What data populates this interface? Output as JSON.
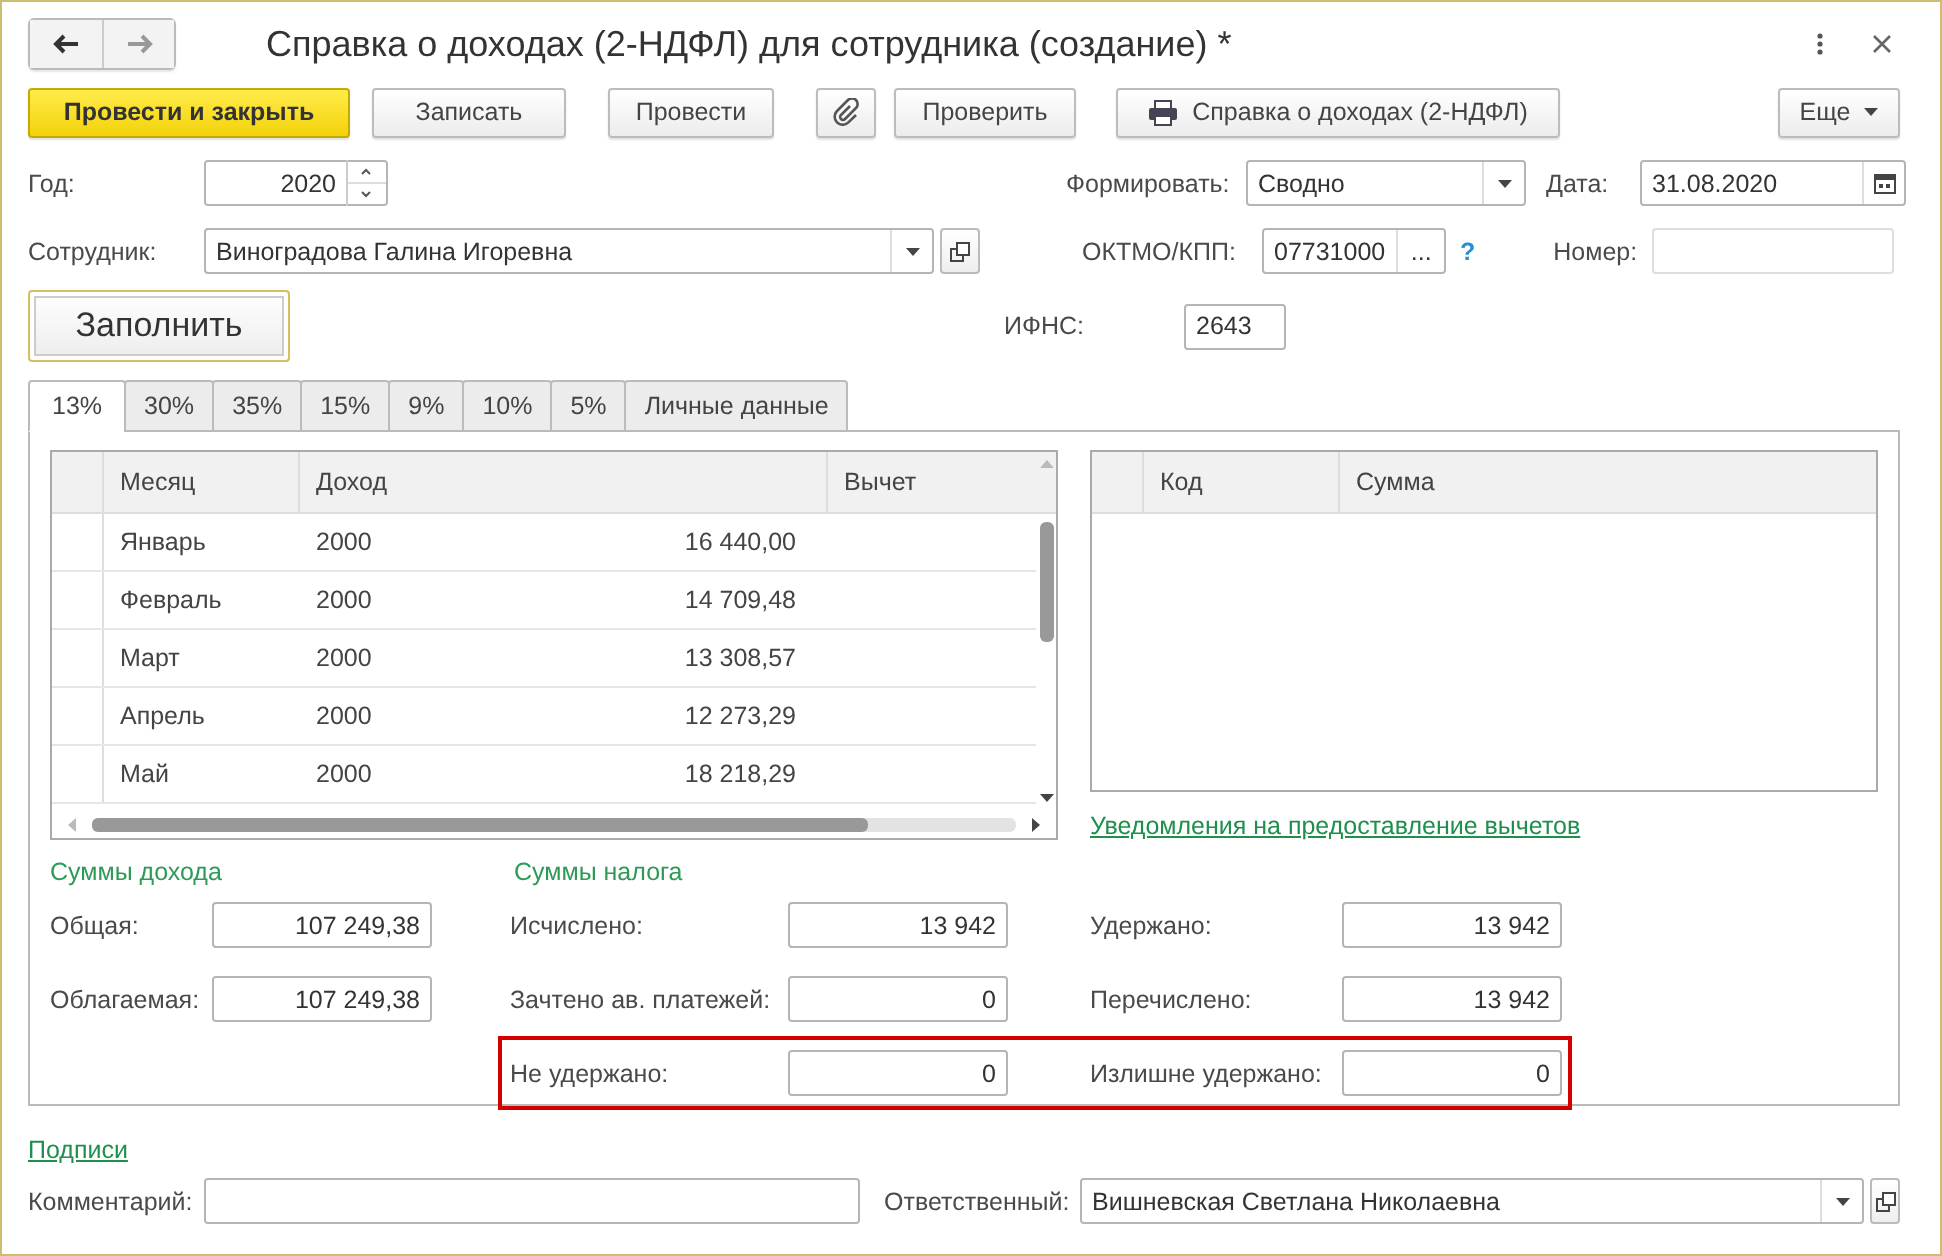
{
  "window": {
    "title": "Справка о доходах (2-НДФЛ) для сотрудника (создание) *"
  },
  "toolbar": [
    {
      "kind": "primary",
      "label": "Провести и закрыть"
    },
    {
      "kind": "plain",
      "label": "Записать"
    },
    {
      "kind": "plain",
      "label": "Провести"
    },
    {
      "kind": "attach"
    },
    {
      "kind": "plain",
      "label": "Проверить"
    },
    {
      "kind": "print",
      "label": "Справка о доходах (2-НДФЛ)"
    },
    {
      "kind": "menu",
      "label": "Еще"
    }
  ],
  "year": {
    "label": "Год:",
    "value": "2020"
  },
  "form_type": {
    "label": "Формировать:",
    "value": "Сводно"
  },
  "date": {
    "label": "Дата:",
    "value": "31.08.2020"
  },
  "employee": {
    "label": "Сотрудник:",
    "value": "Виноградова Галина Игоревна"
  },
  "oktmo": {
    "label": "ОКТМО/КПП:",
    "value": "07731000",
    "choose": "...",
    "help": "?"
  },
  "number": {
    "label": "Номер:",
    "disabled": true
  },
  "fill_button": "Заполнить",
  "ifns": {
    "label": "ИФНС:",
    "value": "2643"
  },
  "tabs": [
    {
      "label": "13%",
      "selected": true
    },
    {
      "label": "30%",
      "selected": false
    },
    {
      "label": "35%",
      "selected": false
    },
    {
      "label": "15%",
      "selected": false
    },
    {
      "label": "9%",
      "selected": false
    },
    {
      "label": "10%",
      "selected": false
    },
    {
      "label": "5%",
      "selected": false
    },
    {
      "label": "Личные данные",
      "selected": false
    }
  ],
  "income_table": {
    "columns": [
      "Месяц",
      "Доход",
      "Вычет"
    ],
    "rows": [
      {
        "month": "Январь",
        "code": "2000",
        "amount": "16 440,00"
      },
      {
        "month": "Февраль",
        "code": "2000",
        "amount": "14 709,48"
      },
      {
        "month": "Март",
        "code": "2000",
        "amount": "13 308,57"
      },
      {
        "month": "Апрель",
        "code": "2000",
        "amount": "12 273,29"
      },
      {
        "month": "Май",
        "code": "2000",
        "amount": "18 218,29"
      }
    ]
  },
  "deduction_table": {
    "columns": [
      "Код",
      "Сумма"
    ]
  },
  "deductions_link": "Уведомления на предоставление вычетов",
  "income_sums": {
    "title": "Суммы дохода",
    "fields": [
      {
        "label": "Общая:",
        "value": "107 249,38"
      },
      {
        "label": "Облагаемая:",
        "value": "107 249,38"
      }
    ]
  },
  "tax_sums": {
    "title": "Суммы налога",
    "rows": [
      {
        "highlighted": false,
        "left": {
          "label": "Исчислено:",
          "value": "13 942"
        },
        "right": {
          "label": "Удержано:",
          "value": "13 942"
        }
      },
      {
        "highlighted": false,
        "left": {
          "label": "Зачтено ав. платежей:",
          "value": "0"
        },
        "right": {
          "label": "Перечислено:",
          "value": "13 942"
        }
      },
      {
        "highlighted": true,
        "left": {
          "label": "Не удержано:",
          "value": "0"
        },
        "right": {
          "label": "Излишне удержано:",
          "value": "0"
        }
      }
    ]
  },
  "signatures_link": "Подписи",
  "comment": {
    "label": "Комментарий:"
  },
  "responsible": {
    "label": "Ответственный:",
    "value": "Вишневская Светлана Николаевна"
  }
}
